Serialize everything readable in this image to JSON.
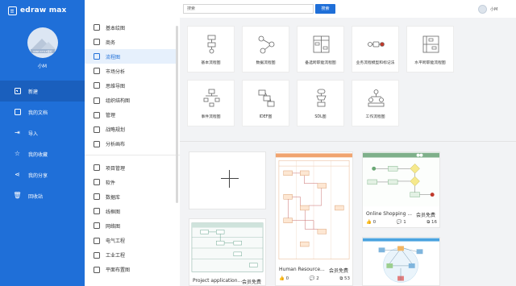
{
  "brand": {
    "name": "edraw max"
  },
  "user": {
    "name": "小M",
    "avatar_caption": "MINT-STYLE图标"
  },
  "nav": [
    {
      "label": "新建",
      "icon": "new-doc-icon",
      "active": true
    },
    {
      "label": "我的文档",
      "icon": "my-docs-icon",
      "active": false
    },
    {
      "label": "导入",
      "icon": "import-icon",
      "active": false
    },
    {
      "label": "我的收藏",
      "icon": "star-icon",
      "active": false
    },
    {
      "label": "我的分享",
      "icon": "share-icon",
      "active": false
    },
    {
      "label": "回收站",
      "icon": "trash-icon",
      "active": false
    }
  ],
  "categories_top": [
    {
      "label": "基本绘图",
      "active": false
    },
    {
      "label": "商务",
      "active": false
    },
    {
      "label": "流程图",
      "active": true
    },
    {
      "label": "市场分析",
      "active": false
    },
    {
      "label": "思维导图",
      "active": false
    },
    {
      "label": "组织结构图",
      "active": false
    },
    {
      "label": "管理",
      "active": false
    },
    {
      "label": "战略规划",
      "active": false
    },
    {
      "label": "分析画布",
      "active": false
    }
  ],
  "categories_bottom": [
    {
      "label": "项目管理"
    },
    {
      "label": "软件"
    },
    {
      "label": "数据库"
    },
    {
      "label": "线框图"
    },
    {
      "label": "网络图"
    },
    {
      "label": "电气工程"
    },
    {
      "label": "工业工程"
    },
    {
      "label": "平面布置图"
    }
  ],
  "search": {
    "placeholder": "搜索",
    "button_label": "搜索"
  },
  "templates": [
    {
      "label": "基本流程图",
      "icon": "basic-flowchart-icon"
    },
    {
      "label": "数据流程图",
      "icon": "data-flow-icon"
    },
    {
      "label": "备选跨职能流程图",
      "icon": "cross-functional-icon"
    },
    {
      "label": "业务流程模型和标记法",
      "icon": "bpmn-icon"
    },
    {
      "label": "水平跨职能流程图",
      "icon": "horizontal-flow-icon"
    },
    {
      "label": "事件流程图",
      "icon": "event-flow-icon"
    },
    {
      "label": "IDEF图",
      "icon": "idef-icon"
    },
    {
      "label": "SDL图",
      "icon": "sdl-icon"
    },
    {
      "label": "工作流程图",
      "icon": "workflow-icon"
    }
  ],
  "examples": [
    {
      "title": "Project application...",
      "badge": "会员免费",
      "likes": "",
      "comments": "",
      "copies": ""
    },
    {
      "title": "Human Resource...",
      "badge": "会员免费",
      "likes": "0",
      "comments": "2",
      "copies": "53"
    },
    {
      "title": "Online Shopping ...",
      "badge": "会员免费",
      "likes": "0",
      "comments": "1",
      "copies": "16"
    }
  ],
  "colors": {
    "primary": "#1f6fd8",
    "primary_dark": "#1a5fbd",
    "background": "#f2f3f5"
  }
}
